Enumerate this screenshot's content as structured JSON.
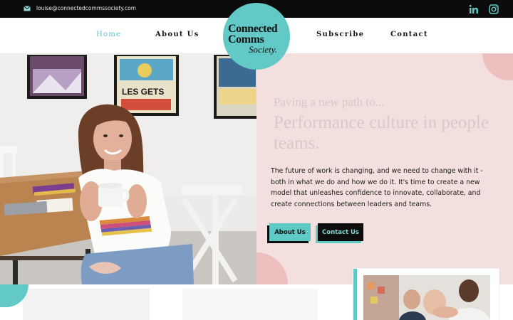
{
  "topbar": {
    "email": "louise@connectedcommssociety.com",
    "social": [
      {
        "icon": "linkedin-icon"
      },
      {
        "icon": "instagram-icon"
      }
    ]
  },
  "nav": {
    "items": [
      {
        "label": "Home",
        "active": true
      },
      {
        "label": "About Us",
        "active": false
      },
      {
        "label": "Subscribe",
        "active": false
      },
      {
        "label": "Contact",
        "active": false
      }
    ],
    "logo": {
      "line1": "Connected",
      "line2": "Comms",
      "line3": "Society."
    }
  },
  "hero": {
    "kicker": "Paving a new path to...",
    "headline": "Performance culture in people teams.",
    "paragraph": "The future of work is changing, and we need to change with it - both in what we do and how we do it. It's time to create a new model that unleashes confidence to innovate, collaborate, and create connections between leaders and teams.",
    "buttons": [
      {
        "label": "About Us"
      },
      {
        "label": "Contact Us"
      }
    ],
    "photo_posters": [
      "LES GETS"
    ]
  },
  "colors": {
    "teal": "#63c9c6",
    "pink": "#f4dfdf",
    "pink_dark": "#eebfbf",
    "black": "#0c0c0c"
  }
}
